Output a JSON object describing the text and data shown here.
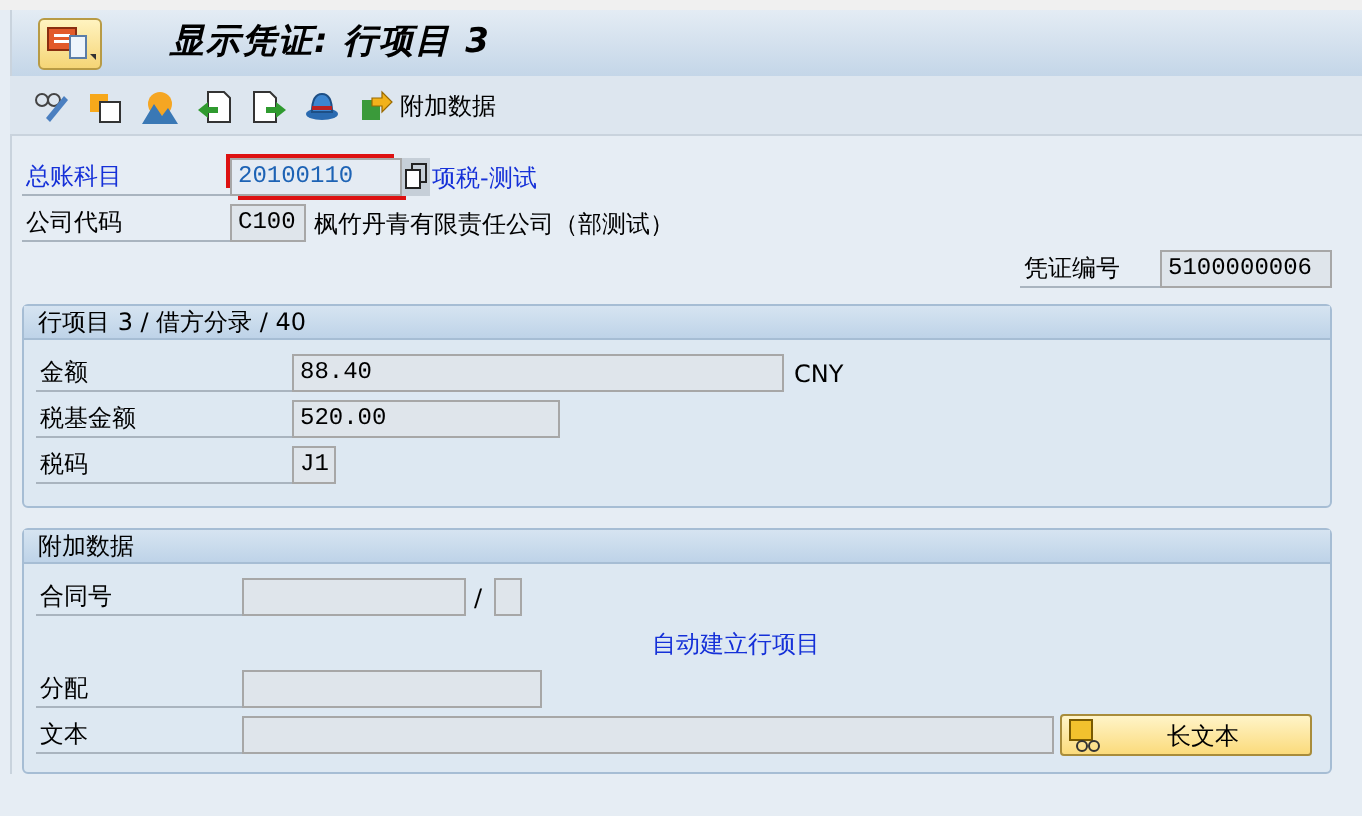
{
  "window": {
    "title": "显示凭证: 行项目 3"
  },
  "toolbar": {
    "button": "附加数据"
  },
  "header_fields": [
    {
      "label": "总账科目",
      "value": "20100110",
      "link": true,
      "focused": true,
      "description": "项税-测试"
    },
    {
      "label": "公司代码",
      "value": "C100",
      "link": false,
      "focused": false,
      "description": "枫竹丹青有限责任公司（部测试）"
    }
  ],
  "document_number": {
    "label": "凭证编号",
    "value": "5100000006"
  },
  "line_item": {
    "title": "行项目 3 / 借方分录 / 40",
    "fields": [
      {
        "label": "金额",
        "value": "88.40",
        "unit": "CNY"
      },
      {
        "label": "税基金额",
        "value": "520.00"
      },
      {
        "label": "税码",
        "value": "J1"
      }
    ]
  },
  "additional_data": {
    "title": "附加数据",
    "contract": {
      "label": "合同号",
      "separator": "/"
    },
    "auto_line": "自动建立行项目",
    "fields": [
      {
        "label": "分配"
      },
      {
        "label": "文本"
      }
    ],
    "long_text_button": "长文本"
  }
}
